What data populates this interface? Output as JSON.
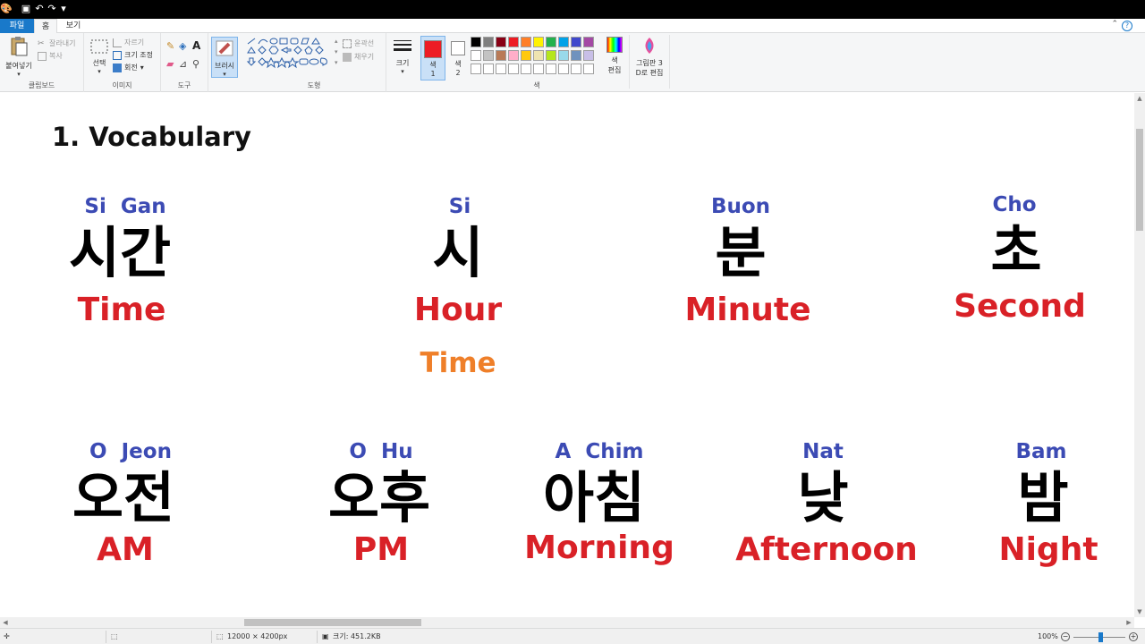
{
  "toolbar_tabs": {
    "file": "파일",
    "home": "홈",
    "view": "보기"
  },
  "ribbon": {
    "clipboard": {
      "paste": "붙여넣기",
      "cut": "잘라내기",
      "copy": "복사",
      "label": "클립보드"
    },
    "image": {
      "select": "선택",
      "crop": "자르기",
      "resize": "크기 조정",
      "rotate": "회전",
      "label": "이미지"
    },
    "tools": {
      "label": "도구"
    },
    "brush": {
      "label": "브러시"
    },
    "shapes": {
      "outline": "윤곽선",
      "fill": "채우기",
      "label": "도형"
    },
    "size": {
      "label": "크기"
    },
    "color1": {
      "line1": "색",
      "line2": "1"
    },
    "color2": {
      "line1": "색",
      "line2": "2"
    },
    "edit_colors": {
      "line1": "색",
      "line2": "편집"
    },
    "paint3d": {
      "line1": "그림판 3",
      "line2": "D로 편집"
    },
    "colors_label": "색",
    "palette": [
      "#000000",
      "#7f7f7f",
      "#880015",
      "#ed1c24",
      "#ff7f27",
      "#fff200",
      "#22b14c",
      "#00a2e8",
      "#3f48cc",
      "#a349a4",
      "#ffffff",
      "#c3c3c3",
      "#b97a57",
      "#ffaec9",
      "#ffc90e",
      "#efe4b0",
      "#b5e61d",
      "#99d9ea",
      "#7092be",
      "#c8bfe7"
    ],
    "color1_value": "#ed1c24",
    "color2_value": "#ffffff"
  },
  "canvas": {
    "heading": "1.  Vocabulary",
    "row1": [
      {
        "rom": "Si  Gan",
        "kor": "시간",
        "eng": "Time"
      },
      {
        "rom": "Si",
        "kor": "시",
        "eng": "Hour",
        "eng2": "Time"
      },
      {
        "rom": "Buon",
        "kor": "분",
        "eng": "Minute"
      },
      {
        "rom": "Cho",
        "kor": "초",
        "eng": "Second"
      }
    ],
    "row2": [
      {
        "rom": "O  Jeon",
        "kor": "오전",
        "eng": "AM"
      },
      {
        "rom": "O  Hu",
        "kor": "오후",
        "eng": "PM"
      },
      {
        "rom": "A  Chim",
        "kor": "아침",
        "eng": "Morning"
      },
      {
        "rom": "Nat",
        "kor": "낮",
        "eng": "Afternoon"
      },
      {
        "rom": "Bam",
        "kor": "밤",
        "eng": "Night"
      }
    ]
  },
  "status": {
    "dimensions": "12000 × 4200px",
    "filesize": "크기: 451.2KB",
    "zoom": "100%"
  }
}
